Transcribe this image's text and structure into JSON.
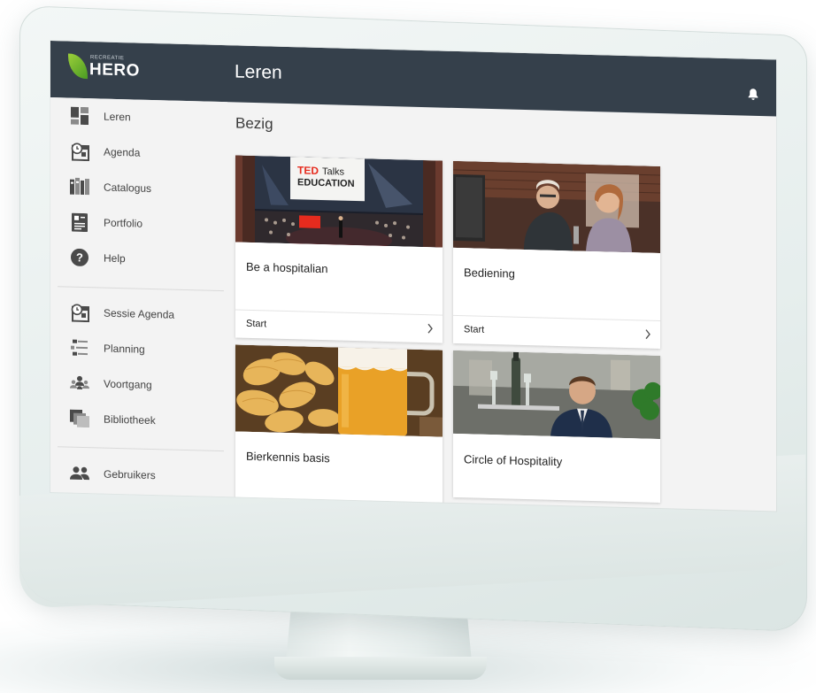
{
  "app": {
    "logo_small": "RECREATIE",
    "logo_big": "HERO",
    "page_title": "Leren"
  },
  "sidebar": {
    "group1": [
      {
        "label": "Leren",
        "icon": "dashboard-icon"
      },
      {
        "label": "Agenda",
        "icon": "agenda-icon"
      },
      {
        "label": "Catalogus",
        "icon": "catalogus-icon"
      },
      {
        "label": "Portfolio",
        "icon": "portfolio-icon"
      },
      {
        "label": "Help",
        "icon": "help-icon"
      }
    ],
    "group2": [
      {
        "label": "Sessie Agenda",
        "icon": "session-agenda-icon"
      },
      {
        "label": "Planning",
        "icon": "planning-icon"
      },
      {
        "label": "Voortgang",
        "icon": "progress-icon"
      },
      {
        "label": "Bibliotheek",
        "icon": "library-icon"
      }
    ],
    "group3": [
      {
        "label": "Gebruikers",
        "icon": "users-icon"
      }
    ]
  },
  "main": {
    "section_title": "Bezig",
    "cards": [
      {
        "title": "Be a hospitalian",
        "action": "Start",
        "image": "ted-education-stage",
        "banner_ted": "TED",
        "banner_talks": "Talks",
        "banner_education": "EDUCATION"
      },
      {
        "title": "Bediening",
        "action": "Start",
        "image": "bar-staff-photo"
      },
      {
        "title": "Bierkennis basis",
        "image": "beer-and-chips-photo"
      },
      {
        "title": "Circle of Hospitality",
        "image": "waiter-with-tray-photo"
      }
    ]
  },
  "colors": {
    "topbar": "#35404b",
    "background": "#f3f3f3",
    "ted_red": "#e62b1e",
    "logo_green": "#6db33f"
  }
}
